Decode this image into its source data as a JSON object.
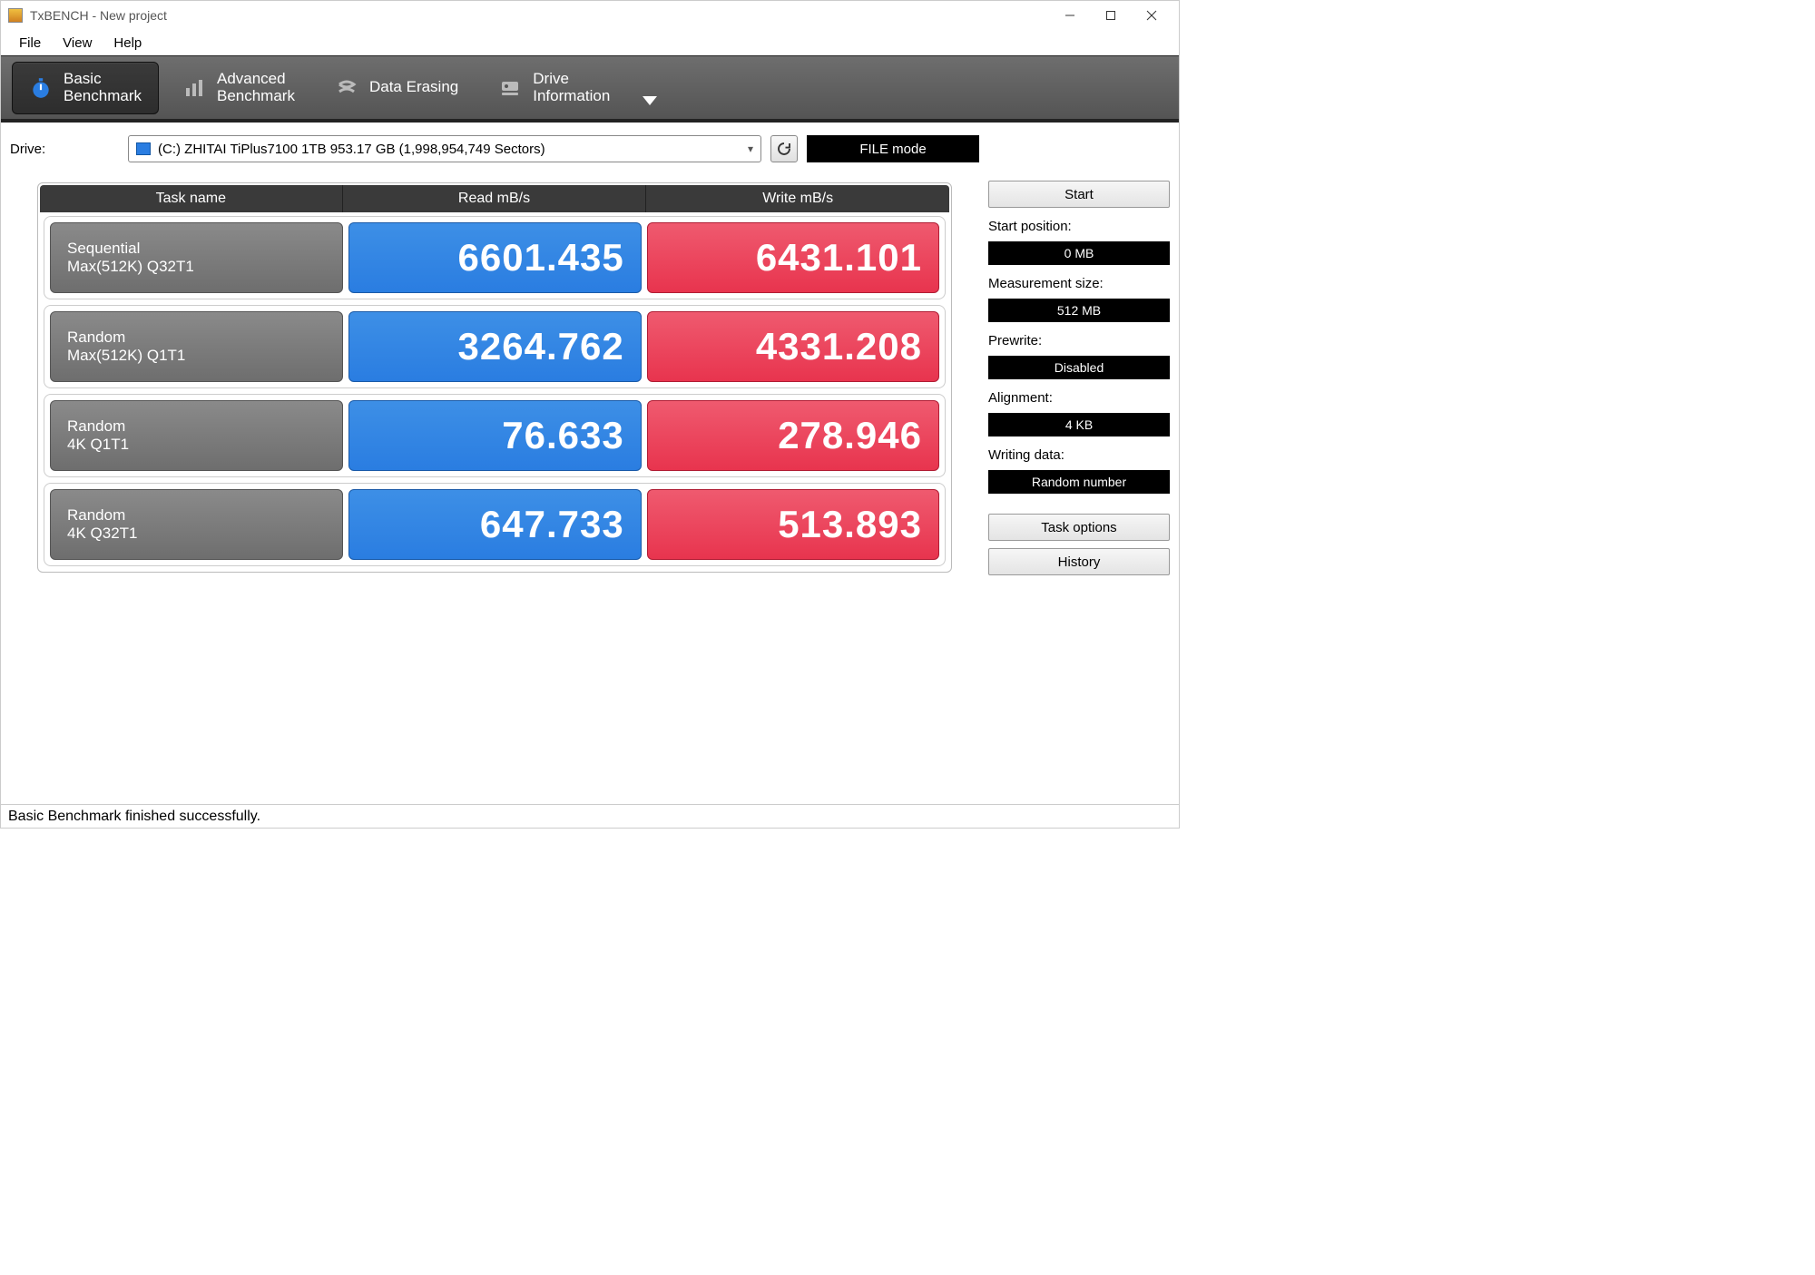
{
  "titlebar": {
    "title": "TxBENCH - New project"
  },
  "menubar": {
    "file": "File",
    "view": "View",
    "help": "Help"
  },
  "tabs": {
    "basic": "Basic\nBenchmark",
    "advanced": "Advanced\nBenchmark",
    "erasing": "Data Erasing",
    "drive": "Drive\nInformation"
  },
  "drive": {
    "label": "Drive:",
    "selected": "(C:) ZHITAI TiPlus7100 1TB  953.17 GB (1,998,954,749 Sectors)",
    "mode": "FILE mode"
  },
  "bench": {
    "headers": {
      "task": "Task name",
      "read": "Read mB/s",
      "write": "Write mB/s"
    },
    "rows": [
      {
        "task1": "Sequential",
        "task2": "Max(512K) Q32T1",
        "read": "6601.435",
        "write": "6431.101"
      },
      {
        "task1": "Random",
        "task2": "Max(512K) Q1T1",
        "read": "3264.762",
        "write": "4331.208"
      },
      {
        "task1": "Random",
        "task2": "4K Q1T1",
        "read": "76.633",
        "write": "278.946"
      },
      {
        "task1": "Random",
        "task2": "4K Q32T1",
        "read": "647.733",
        "write": "513.893"
      }
    ]
  },
  "side": {
    "start": "Start",
    "start_pos_label": "Start position:",
    "start_pos_value": "0 MB",
    "meas_label": "Measurement size:",
    "meas_value": "512 MB",
    "prewrite_label": "Prewrite:",
    "prewrite_value": "Disabled",
    "align_label": "Alignment:",
    "align_value": "4 KB",
    "wdata_label": "Writing data:",
    "wdata_value": "Random number",
    "task_options": "Task options",
    "history": "History"
  },
  "status": "Basic Benchmark finished successfully.",
  "chart_data": {
    "type": "table",
    "title": "TxBENCH Basic Benchmark Results (mB/s)",
    "columns": [
      "Task",
      "Read mB/s",
      "Write mB/s"
    ],
    "rows": [
      [
        "Sequential Max(512K) Q32T1",
        6601.435,
        6431.101
      ],
      [
        "Random Max(512K) Q1T1",
        3264.762,
        4331.208
      ],
      [
        "Random 4K Q1T1",
        76.633,
        278.946
      ],
      [
        "Random 4K Q32T1",
        647.733,
        513.893
      ]
    ]
  }
}
